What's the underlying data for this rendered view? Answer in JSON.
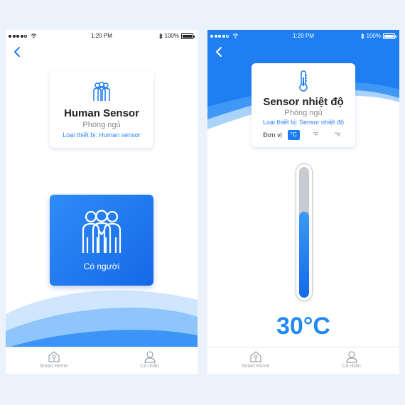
{
  "colors": {
    "accent": "#1e7cf2",
    "page_bg": "#ebf2fc",
    "wave_light": "#a9d3fb"
  },
  "left_screen": {
    "status": {
      "time": "1:20 PM",
      "battery": "100%"
    },
    "device_card": {
      "icon": "people-icon",
      "title": "Human Sensor",
      "room": "Phòng ngủ",
      "device_type": "Loại thiết bị: Human sensor"
    },
    "presence_tile": {
      "icon": "people-icon",
      "label": "Có người"
    },
    "tabbar": {
      "home_label": "Smart Home",
      "profile_label": "Cá nhân"
    }
  },
  "right_screen": {
    "status": {
      "time": "1:20 PM",
      "battery": "100%"
    },
    "device_card": {
      "icon": "thermometer-icon",
      "title": "Sensor nhiệt độ",
      "room": "Phòng ngủ",
      "device_type": "Loại thiết bị: Sensor nhiệt độ",
      "unit_label": "Đơn vị",
      "units": [
        "°C",
        "°F",
        "°K"
      ],
      "selected_unit": "°C"
    },
    "thermometer": {
      "level_fraction": 0.66
    },
    "temperature": "30°C",
    "tabbar": {
      "home_label": "Smart Home",
      "profile_label": "Cá nhân"
    }
  }
}
